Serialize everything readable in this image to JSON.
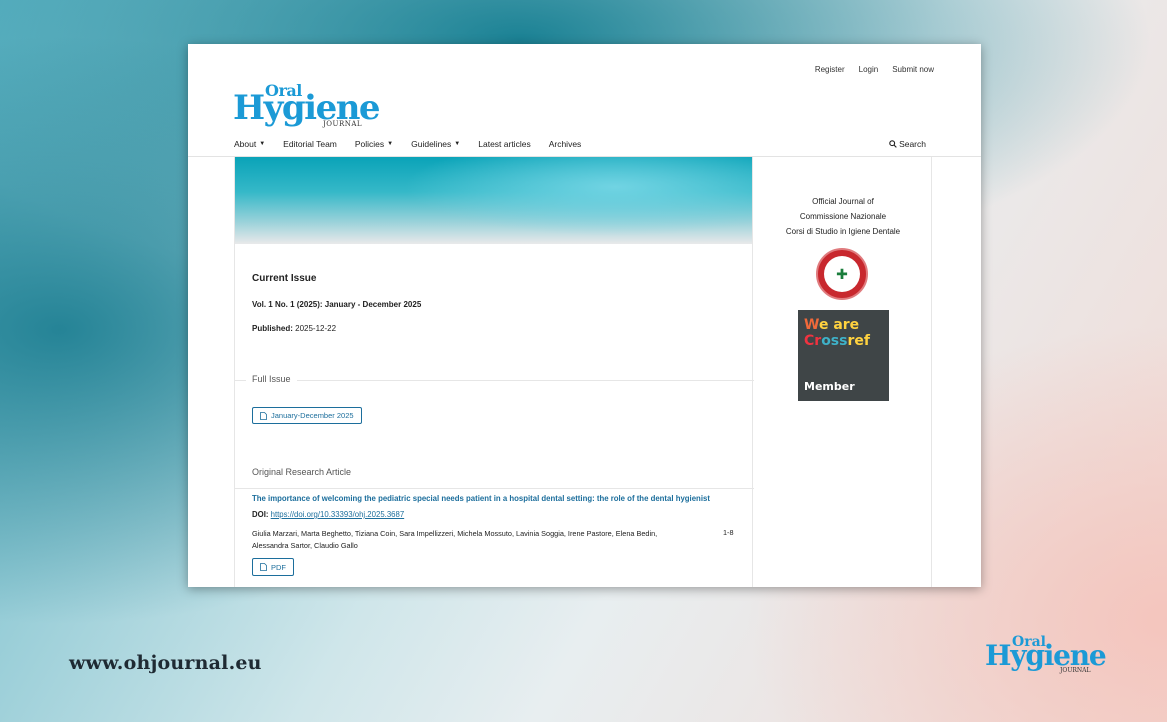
{
  "header": {
    "links": [
      "Register",
      "Login",
      "Submit now"
    ],
    "logo": {
      "top": "Oral",
      "main": "Hygiene",
      "sub": "JOURNAL"
    }
  },
  "nav": {
    "items": [
      {
        "label": "About",
        "caret": true
      },
      {
        "label": "Editorial Team",
        "caret": false
      },
      {
        "label": "Policies",
        "caret": true
      },
      {
        "label": "Guidelines",
        "caret": true
      },
      {
        "label": "Latest articles",
        "caret": false
      },
      {
        "label": "Archives",
        "caret": false
      }
    ],
    "search_label": "Search"
  },
  "issue": {
    "heading": "Current Issue",
    "volume": "Vol. 1 No. 1 (2025): January - December 2025",
    "published_label": "Published:",
    "published_date": "2025-12-22",
    "full_issue_label": "Full Issue",
    "full_issue_button": "January-December 2025",
    "section_label": "Original Research Article"
  },
  "article": {
    "title": "The importance of welcoming the pediatric special needs patient in a hospital dental setting: the role of the dental hygienist",
    "doi_label": "DOI:",
    "doi_link": "https://doi.org/10.33393/ohj.2025.3687",
    "authors": "Giulia Marzari, Marta Beghetto, Tiziana Coin, Sara Impellizzeri, Michela Mossuto, Lavinia Soggia, Irene Pastore, Elena Bedin, Alessandra Sartor, Claudio Gallo",
    "pages": "1-8",
    "pdf_button": "PDF"
  },
  "sidebar": {
    "official_lines": [
      "Official Journal of",
      "Commissione Nazionale",
      "Corsi di Studio in Igiene Dentale"
    ],
    "crossref": {
      "line1_a": "W",
      "line1_b": "e are",
      "line2_a": "Cr",
      "line2_b": "oss",
      "line2_c": "ref",
      "member": "Member"
    }
  },
  "footer": {
    "url": "www.ohjournal.eu",
    "logo": {
      "top": "Oral",
      "main": "Hygiene",
      "sub": "JOURNAL"
    }
  },
  "colors": {
    "brand_blue": "#1b9ad6",
    "link_blue": "#1c6e9c"
  }
}
